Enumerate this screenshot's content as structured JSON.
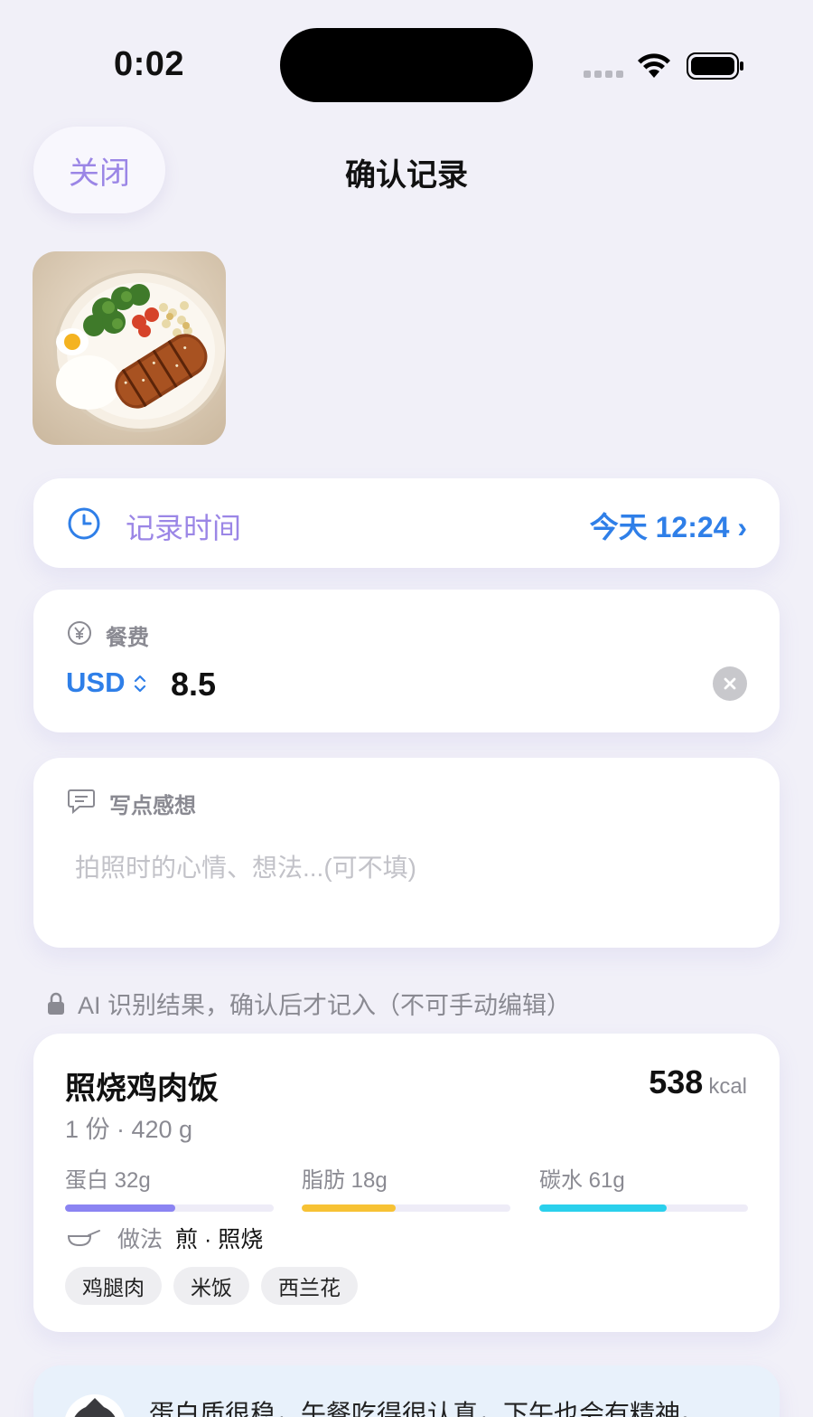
{
  "status": {
    "time": "0:02"
  },
  "nav": {
    "close_label": "关闭",
    "title": "确认记录"
  },
  "record_time": {
    "label": "记录时间",
    "value": "今天 12:24 ›"
  },
  "fee": {
    "label": "餐费",
    "currency": "USD",
    "amount": "8.5"
  },
  "note": {
    "label": "写点感想",
    "placeholder": "拍照时的心情、想法...(可不填)"
  },
  "ai_note": "AI 识别结果，确认后才记入（不可手动编辑）",
  "food": {
    "name": "照烧鸡肉饭",
    "calories": "538",
    "calories_unit": "kcal",
    "portion": "1 份 · 420 g",
    "macros": [
      {
        "label": "蛋白 32g",
        "fraction": 0.53,
        "color": "#8b84f2"
      },
      {
        "label": "脂肪 18g",
        "fraction": 0.45,
        "color": "#f7c234"
      },
      {
        "label": "碳水 61g",
        "fraction": 0.61,
        "color": "#2ad0ec"
      }
    ],
    "method_label": "做法",
    "method_value": "煎 · 照烧",
    "tags": [
      "鸡腿肉",
      "米饭",
      "西兰花"
    ]
  },
  "tip": {
    "text": "蛋白质很稳，午餐吃得很认真，下午也会有精神。"
  },
  "icons": [
    "wifi-icon",
    "battery-icon",
    "clock-icon",
    "yen-icon",
    "chevron-updown-icon",
    "clear-icon",
    "chat-bubble-icon",
    "lock-icon",
    "cooking-pan-icon"
  ]
}
